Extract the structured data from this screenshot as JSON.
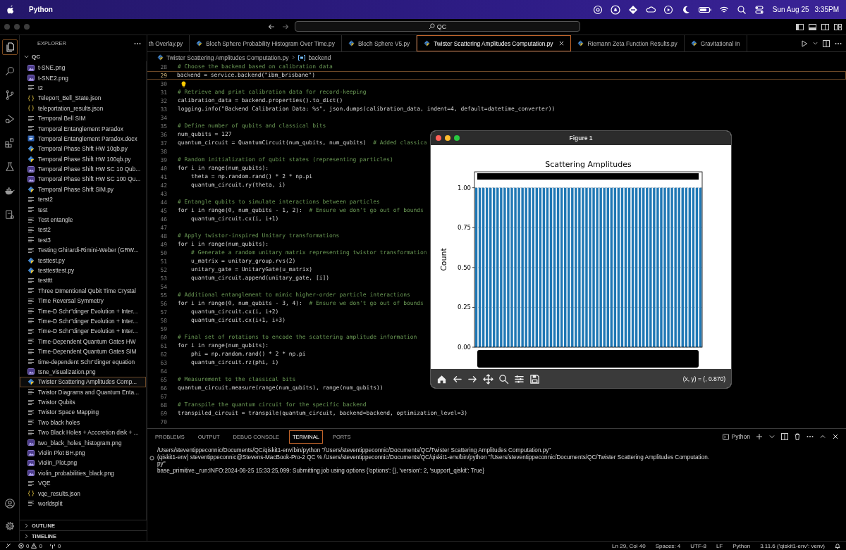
{
  "menubar": {
    "app": "Python",
    "date": "Sun Aug 25",
    "time": "3:35PM"
  },
  "titlebar": {
    "search": "QC"
  },
  "activity_bar": {
    "items": [
      {
        "kind": "explorer",
        "selected": true
      },
      {
        "kind": "search",
        "selected": false
      },
      {
        "kind": "scm",
        "selected": false
      },
      {
        "kind": "debug",
        "selected": false
      },
      {
        "kind": "extensions",
        "selected": false
      },
      {
        "kind": "testing",
        "selected": false
      },
      {
        "kind": "docker",
        "selected": false
      },
      {
        "kind": "remote",
        "selected": false
      },
      {
        "kind": "account",
        "selected": false
      },
      {
        "kind": "settings",
        "selected": false
      }
    ]
  },
  "sidebar": {
    "title": "EXPLORER",
    "folder": "QC",
    "files": [
      {
        "name": "t-SNE.png",
        "kind": "image",
        "selected": false
      },
      {
        "name": "t-SNE2.png",
        "kind": "image",
        "selected": false
      },
      {
        "name": "t2",
        "kind": "text",
        "selected": false
      },
      {
        "name": "Teleport_Bell_State.json",
        "kind": "json",
        "selected": false
      },
      {
        "name": "teleportation_results.json",
        "kind": "json",
        "selected": false
      },
      {
        "name": "Temporal Bell SIM",
        "kind": "text",
        "selected": false
      },
      {
        "name": "Temporal Entanglement Paradox",
        "kind": "text",
        "selected": false
      },
      {
        "name": "Temporal Entanglement Paradox.docx",
        "kind": "word",
        "selected": false
      },
      {
        "name": "Temporal Phase Shift HW 10qb.py",
        "kind": "python",
        "selected": false
      },
      {
        "name": "Temporal Phase Shift HW 100qb.py",
        "kind": "python",
        "selected": false
      },
      {
        "name": "Temporal Phase Shift HW SC 10 Qub...",
        "kind": "image",
        "selected": false
      },
      {
        "name": "Temporal Phase Shift HW SC 100 Qu...",
        "kind": "image",
        "selected": false
      },
      {
        "name": "Temporal Phase Shift SIM.py",
        "kind": "python",
        "selected": false
      },
      {
        "name": "terst2",
        "kind": "text",
        "selected": false
      },
      {
        "name": "test",
        "kind": "text",
        "selected": false
      },
      {
        "name": "Test entangle",
        "kind": "text",
        "selected": false
      },
      {
        "name": "test2",
        "kind": "text",
        "selected": false
      },
      {
        "name": "test3",
        "kind": "text",
        "selected": false
      },
      {
        "name": "Testing Ghirardi-Rimini-Weber (GRW...",
        "kind": "text",
        "selected": false
      },
      {
        "name": "testtest.py",
        "kind": "python",
        "selected": false
      },
      {
        "name": "testtesttest.py",
        "kind": "python",
        "selected": false
      },
      {
        "name": "testttt",
        "kind": "text",
        "selected": false
      },
      {
        "name": "Three DImentional Qubit Time Crystal",
        "kind": "text",
        "selected": false
      },
      {
        "name": "Time Reversal Symmetry",
        "kind": "text",
        "selected": false
      },
      {
        "name": "Time-D Schr\"dinger Evolution + Inter...",
        "kind": "text",
        "selected": false
      },
      {
        "name": "Time-D Schr\"dinger Evolution + Inter...",
        "kind": "text",
        "selected": false
      },
      {
        "name": "Time-D Schr\"dinger Evolution + Inter...",
        "kind": "text",
        "selected": false
      },
      {
        "name": "Time-Dependent Quantum Gates HW",
        "kind": "text",
        "selected": false
      },
      {
        "name": "Time-Dependent Quantum Gates SIM",
        "kind": "text",
        "selected": false
      },
      {
        "name": "time-dependent Schr\"dinger equation",
        "kind": "text",
        "selected": false
      },
      {
        "name": "tsne_visualization.png",
        "kind": "image",
        "selected": false
      },
      {
        "name": "Twister Scattering Amplitudes Comp...",
        "kind": "python",
        "selected": true
      },
      {
        "name": "Twistor Diagrams and Quantum Enta...",
        "kind": "text",
        "selected": false
      },
      {
        "name": "Twistor Qubits",
        "kind": "text",
        "selected": false
      },
      {
        "name": "Twistor Space Mapping",
        "kind": "text",
        "selected": false
      },
      {
        "name": "Two black holes",
        "kind": "text",
        "selected": false
      },
      {
        "name": "Two Black Holes + Acccretion disk + ...",
        "kind": "text",
        "selected": false
      },
      {
        "name": "two_black_holes_histogram.png",
        "kind": "image",
        "selected": false
      },
      {
        "name": "Violin Plot BH.png",
        "kind": "image",
        "selected": false
      },
      {
        "name": "Violin_Plot.png",
        "kind": "image",
        "selected": false
      },
      {
        "name": "violin_probabilities_black.png",
        "kind": "image",
        "selected": false
      },
      {
        "name": "VQE",
        "kind": "text",
        "selected": false
      },
      {
        "name": "vqe_results.json",
        "kind": "json",
        "selected": false
      },
      {
        "name": "worldsplit",
        "kind": "text",
        "selected": false
      }
    ],
    "sections": [
      {
        "label": "OUTLINE"
      },
      {
        "label": "TIMELINE"
      }
    ]
  },
  "tabs": [
    {
      "label": "th Overlay.py",
      "selected": false
    },
    {
      "label": "Bloch Sphere Probability Histogram Over Time.py",
      "selected": false
    },
    {
      "label": "Bloch Sphere V5.py",
      "selected": false
    },
    {
      "label": "Twister Scattering Amplitudes Computation.py",
      "selected": true
    },
    {
      "label": "Riemann Zeta Function Results.py",
      "selected": false
    },
    {
      "label": "Gravitational In",
      "selected": false
    }
  ],
  "breadcrumb": {
    "file": "Twister Scattering Amplitudes Computation.py",
    "symbol": "backend"
  },
  "editor": {
    "lines": [
      {
        "number": "28",
        "comment": "# Choose the backend based on calibration data",
        "current": false
      },
      {
        "number": "29",
        "code": "backend = service.backend(\"ibm_brisbane\")",
        "current": true
      },
      {
        "number": "30",
        "current": false,
        "lightbulb": true
      },
      {
        "number": "31",
        "comment": "# Retrieve and print calibration data for record-keeping",
        "current": false
      },
      {
        "number": "32",
        "code": "calibration_data = backend.properties().to_dict()",
        "current": false
      },
      {
        "number": "33",
        "code": "logging.info(\"Backend Calibration Data: %s\", json.dumps(calibration_data, indent=4, default=datetime_converter))",
        "current": false
      },
      {
        "number": "34",
        "current": false
      },
      {
        "number": "35",
        "comment": "# Define number of qubits and classical bits",
        "current": false
      },
      {
        "number": "36",
        "code": "num_qubits = 127",
        "current": false
      },
      {
        "number": "37",
        "code": "quantum_circuit = QuantumCircuit(num_qubits, num_qubits)  ",
        "comment": "# Added classica",
        "current": false
      },
      {
        "number": "38",
        "current": false
      },
      {
        "number": "39",
        "comment": "# Random initialization of qubit states (representing particles)",
        "current": false
      },
      {
        "number": "40",
        "code": "for i in range(num_qubits):",
        "current": false
      },
      {
        "number": "41",
        "code": "    theta = np.random.rand() * 2 * np.pi",
        "current": false
      },
      {
        "number": "42",
        "code": "    quantum_circuit.ry(theta, i)",
        "current": false
      },
      {
        "number": "43",
        "current": false
      },
      {
        "number": "44",
        "comment": "# Entangle qubits to simulate interactions between particles",
        "current": false
      },
      {
        "number": "45",
        "code": "for i in range(0, num_qubits - 1, 2):  ",
        "comment": "# Ensure we don't go out of bounds",
        "current": false
      },
      {
        "number": "46",
        "code": "    quantum_circuit.cx(i, i+1)",
        "current": false
      },
      {
        "number": "47",
        "current": false
      },
      {
        "number": "48",
        "comment": "# Apply twistor-inspired Unitary transformations",
        "current": false
      },
      {
        "number": "49",
        "code": "for i in range(num_qubits):",
        "current": false
      },
      {
        "number": "50",
        "comment": "    # Generate a random unitary matrix representing twistor transformation",
        "current": false
      },
      {
        "number": "51",
        "code": "    u_matrix = unitary_group.rvs(2)",
        "current": false
      },
      {
        "number": "52",
        "code": "    unitary_gate = UnitaryGate(u_matrix)",
        "current": false
      },
      {
        "number": "53",
        "code": "    quantum_circuit.append(unitary_gate, [i])",
        "current": false
      },
      {
        "number": "54",
        "current": false
      },
      {
        "number": "55",
        "comment": "# Additional entanglement to mimic higher-order particle interactions",
        "current": false
      },
      {
        "number": "56",
        "code": "for i in range(0, num_qubits - 3, 4):  ",
        "comment": "# Ensure we don't go out of bounds",
        "current": false
      },
      {
        "number": "57",
        "code": "    quantum_circuit.cx(i, i+2)",
        "current": false
      },
      {
        "number": "58",
        "code": "    quantum_circuit.cx(i+1, i+3)",
        "current": false
      },
      {
        "number": "59",
        "current": false
      },
      {
        "number": "60",
        "comment": "# Final set of rotations to encode the scattering amplitude information",
        "current": false
      },
      {
        "number": "61",
        "code": "for i in range(num_qubits):",
        "current": false
      },
      {
        "number": "62",
        "code": "    phi = np.random.rand() * 2 * np.pi",
        "current": false
      },
      {
        "number": "63",
        "code": "    quantum_circuit.rz(phi, i)",
        "current": false
      },
      {
        "number": "64",
        "current": false
      },
      {
        "number": "65",
        "comment": "# Measurement to the classical bits",
        "current": false
      },
      {
        "number": "66",
        "code": "quantum_circuit.measure(range(num_qubits), range(num_qubits))",
        "current": false
      },
      {
        "number": "67",
        "current": false
      },
      {
        "number": "68",
        "comment": "# Transpile the quantum circuit for the specific backend",
        "current": false
      },
      {
        "number": "69",
        "code": "transpiled_circuit = transpile(quantum_circuit, backend=backend, optimization_level=3)",
        "current": false
      },
      {
        "number": "70",
        "current": false
      }
    ]
  },
  "figure": {
    "title": "Figure 1",
    "coordinates": "(x, y) = (, 0.870)",
    "chart_data": {
      "type": "bar",
      "title": "Scattering Amplitudes",
      "ylabel": "Count",
      "ylim": [
        0,
        1.1
      ],
      "grid": true,
      "yticks": [
        {
          "value": 0,
          "label": "0.00"
        },
        {
          "value": 0.25,
          "label": "0.25"
        },
        {
          "value": 0.5,
          "label": "0.50"
        },
        {
          "value": 0.75,
          "label": "0.75"
        },
        {
          "value": 1,
          "label": "1.00"
        }
      ],
      "values": [
        1,
        1,
        1,
        1,
        1,
        1,
        1,
        1,
        1,
        1,
        1,
        1,
        1,
        1,
        1,
        1,
        1,
        1,
        1,
        1,
        1,
        1,
        1,
        1,
        1,
        1,
        1,
        1,
        1,
        1,
        1,
        1,
        1,
        1,
        1,
        1,
        1,
        1,
        1,
        1,
        1,
        1,
        1,
        1,
        1,
        1,
        1,
        1,
        1,
        1,
        1,
        1,
        1,
        1,
        1,
        1,
        1,
        1,
        1,
        1,
        1,
        1,
        1,
        1
      ]
    }
  },
  "panel": {
    "tabs": [
      {
        "label": "PROBLEMS",
        "selected": false
      },
      {
        "label": "OUTPUT",
        "selected": false
      },
      {
        "label": "DEBUG CONSOLE",
        "selected": false
      },
      {
        "label": "TERMINAL",
        "selected": true
      },
      {
        "label": "PORTS",
        "selected": false
      }
    ],
    "terminal_label": "Python",
    "lines": [
      {
        "text": "/Users/steventippeconnic/Documents/QC/qiskit1-env/bin/python \"/Users/steventippeconnic/Documents/QC/Twister Scattering Amplitudes Computation.py\"",
        "marker": false
      },
      {
        "text": "(qiskit1-env) steventippeconnic@Stevens-MacBook-Pro-2 QC % /Users/steventippeconnic/Documents/QC/qiskit1-env/bin/python \"/Users/steventippeconnic/Documents/QC/Twister Scattering Amplitudes Computation.",
        "marker": true
      },
      {
        "text": "py\"",
        "marker": false
      },
      {
        "text": "base_primitive._run:INFO:2024-08-25 15:33:25,099: Submitting job using options {'options': {}, 'version': 2, 'support_qiskit': True}",
        "marker": false
      }
    ]
  },
  "status_bar": {
    "errors": "0",
    "warnings": "0",
    "ports": "0",
    "items": [
      "Ln 29, Col 40",
      "Spaces: 4",
      "UTF-8",
      "LF",
      "Python",
      "3.11.6 ('qiskit1-env': venv)"
    ]
  }
}
